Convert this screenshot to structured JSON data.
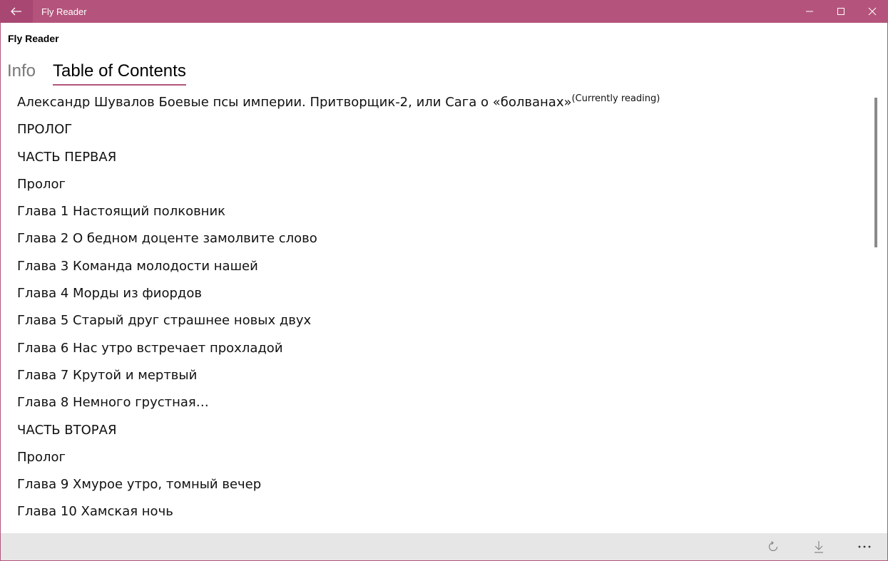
{
  "window": {
    "title": "Fly Reader",
    "accent_color": "#b4547c",
    "controls": [
      "minimize-icon",
      "maximize-icon",
      "close-icon"
    ]
  },
  "app": {
    "title": "Fly Reader"
  },
  "tabs": [
    {
      "label": "Info",
      "active": false
    },
    {
      "label": "Table of Contents",
      "active": true
    }
  ],
  "toc": {
    "current_marker": "(Currently reading)",
    "items": [
      "Александр Шувалов Боевые псы империи. Притворщик-2, или Сага о «болванах»",
      "ПРОЛОГ",
      "ЧАСТЬ ПЕРВАЯ",
      "Пролог",
      "Глава 1 Настоящий полковник",
      "Глава 2 О бедном доценте замолвите слово",
      "Глава 3 Команда молодости нашей",
      "Глава 4 Морды из фиордов",
      "Глава 5 Старый друг страшнее новых двух",
      "Глава 6 Нас утро встречает прохладой",
      "Глава 7 Крутой и мертвый",
      "Глава 8 Немного грустная…",
      "ЧАСТЬ ВТОРАЯ",
      "Пролог",
      "Глава 9 Хмурое утро, томный вечер",
      "Глава 10 Хамская ночь"
    ]
  },
  "bottom_bar": {
    "icons": [
      "refresh-icon",
      "download-icon",
      "more-icon"
    ],
    "more_label": "..."
  }
}
